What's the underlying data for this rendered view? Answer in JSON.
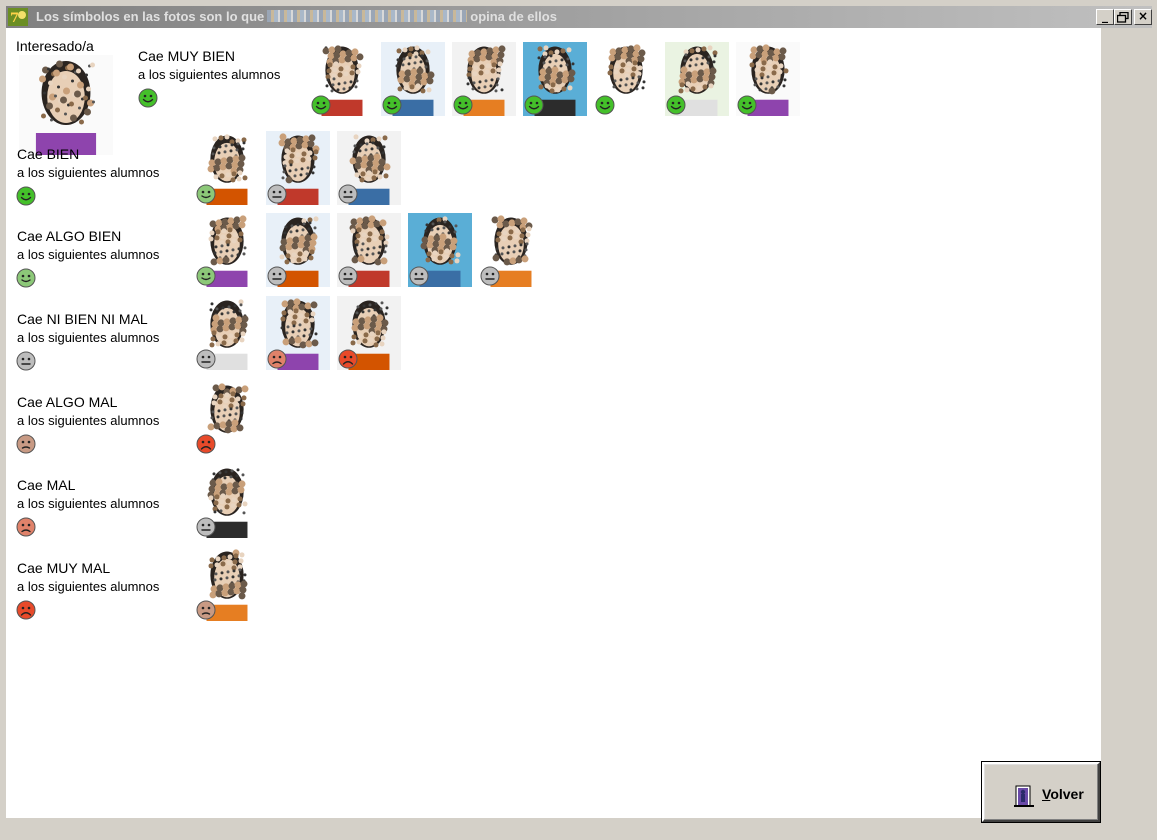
{
  "window": {
    "title_prefix": "Los símbolos en las fotos son lo que",
    "title_suffix": "opina de ellos",
    "buttons": {
      "minimize": "_",
      "restore": "▫",
      "close": "×"
    }
  },
  "interesado": {
    "label": "Interesado/a"
  },
  "groups": [
    {
      "title": "Cae MUY BIEN",
      "subtitle": "a los siguientes alumnos",
      "smiley": "very-good",
      "photos": [
        "very-good",
        "very-good",
        "very-good",
        "very-good",
        "very-good",
        "very-good",
        "very-good"
      ]
    },
    {
      "title": "Cae BIEN",
      "subtitle": "a los siguientes alumnos",
      "smiley": "very-good",
      "photos": [
        "good",
        "neutral",
        "neutral"
      ]
    },
    {
      "title": "Cae ALGO BIEN",
      "subtitle": "a los siguientes alumnos",
      "smiley": "good",
      "photos": [
        "good",
        "neutral",
        "neutral",
        "neutral",
        "neutral"
      ]
    },
    {
      "title": "Cae NI BIEN NI MAL",
      "subtitle": "a los siguientes alumnos",
      "smiley": "neutral",
      "photos": [
        "neutral",
        "bad",
        "very-bad"
      ]
    },
    {
      "title": "Cae ALGO MAL",
      "subtitle": "a los siguientes alumnos",
      "smiley": "slightly-bad",
      "photos": [
        "very-bad"
      ]
    },
    {
      "title": "Cae MAL",
      "subtitle": "a los siguientes alumnos",
      "smiley": "bad",
      "photos": [
        "neutral"
      ]
    },
    {
      "title": "Cae MUY MAL",
      "subtitle": "a los siguientes alumnos",
      "smiley": "very-bad",
      "photos": [
        "slightly-bad"
      ]
    }
  ],
  "smiley_colors": {
    "very-good": "#44c02a",
    "good": "#8cc878",
    "neutral": "#bdbdbd",
    "slightly-bad": "#c89a84",
    "bad": "#e0826a",
    "very-bad": "#e84a2a"
  },
  "volver": {
    "mnemonic": "V",
    "rest": "olver"
  }
}
